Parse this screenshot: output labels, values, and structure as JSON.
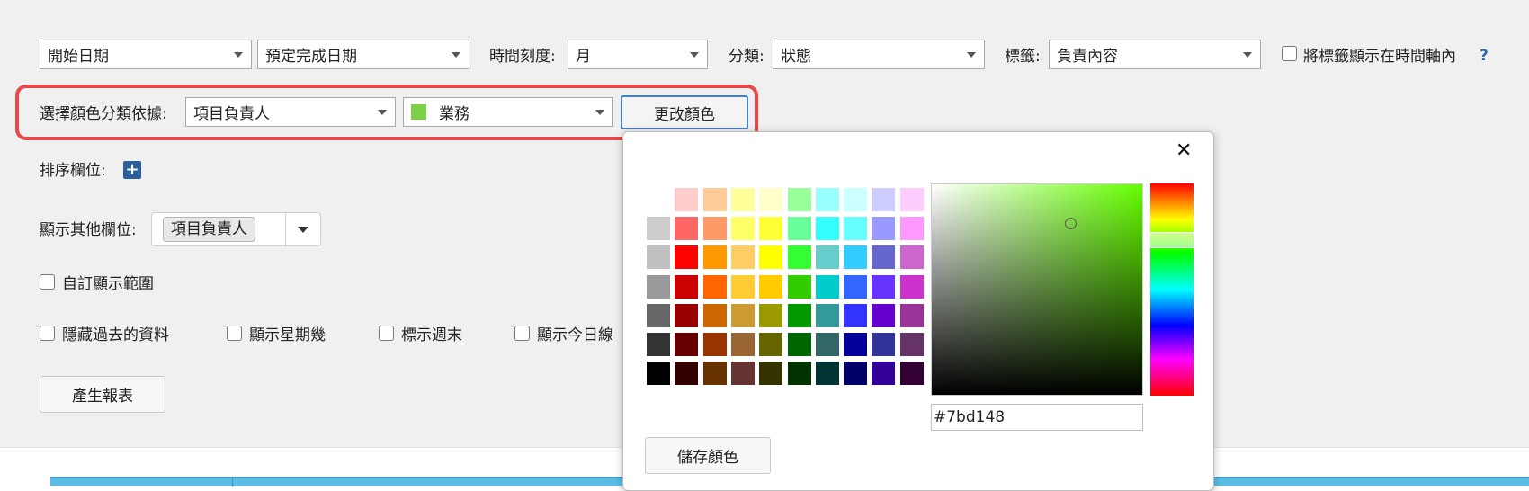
{
  "filters": {
    "start_date": "開始日期",
    "due_date": "預定完成日期",
    "time_scale_label": "時間刻度:",
    "time_scale_value": "月",
    "category_label": "分類:",
    "category_value": "狀態",
    "tag_label": "標籤:",
    "tag_value": "負責內容",
    "show_tags_label": "將標籤顯示在時間軸內",
    "help": "?"
  },
  "color_row": {
    "label": "選擇顏色分類依據:",
    "field_value": "項目負責人",
    "group_value": "業務",
    "group_color": "#7bd148",
    "change_button": "更改顏色"
  },
  "sort": {
    "label": "排序欄位:",
    "add_icon": "plus-icon"
  },
  "other_fields": {
    "label": "顯示其他欄位:",
    "chip": "項目負責人"
  },
  "custom_range": {
    "label": "自訂顯示範圍"
  },
  "options": {
    "hide_past": "隱藏過去的資料",
    "show_weekday": "顯示星期幾",
    "mark_weekend": "標示週末",
    "show_today": "顯示今日線"
  },
  "generate_button": "產生報表",
  "color_picker": {
    "close": "✕",
    "palette": [
      [
        "#ffffff",
        "#ffcccc",
        "#ffcc99",
        "#ffff99",
        "#ffffcc",
        "#99ff99",
        "#99ffff",
        "#ccffff",
        "#ccccff",
        "#ffccff"
      ],
      [
        "#cccccc",
        "#ff6666",
        "#ff9966",
        "#ffff66",
        "#ffff33",
        "#66ff99",
        "#33ffff",
        "#66ffff",
        "#9999ff",
        "#ff99ff"
      ],
      [
        "#c0c0c0",
        "#ff0000",
        "#ff9900",
        "#ffcc66",
        "#ffff00",
        "#33ff33",
        "#66cccc",
        "#33ccff",
        "#6666cc",
        "#cc66cc"
      ],
      [
        "#999999",
        "#cc0000",
        "#ff6600",
        "#ffcc33",
        "#ffcc00",
        "#33cc00",
        "#00cccc",
        "#3366ff",
        "#6633ff",
        "#cc33cc"
      ],
      [
        "#666666",
        "#990000",
        "#cc6600",
        "#cc9933",
        "#999900",
        "#009900",
        "#339999",
        "#3333ff",
        "#6600cc",
        "#993399"
      ],
      [
        "#333333",
        "#660000",
        "#993300",
        "#996633",
        "#666600",
        "#006600",
        "#336666",
        "#000099",
        "#333399",
        "#663366"
      ],
      [
        "#000000",
        "#330000",
        "#663300",
        "#663333",
        "#333300",
        "#003300",
        "#003333",
        "#000066",
        "#330099",
        "#330033"
      ]
    ],
    "hue_color": "#66ff00",
    "hex_value": "#7bd148",
    "save_button": "儲存顏色"
  },
  "colors": {
    "highlight": "#e84848",
    "accent_blue": "#2a6cb3",
    "table_header": "#5bbde4"
  }
}
